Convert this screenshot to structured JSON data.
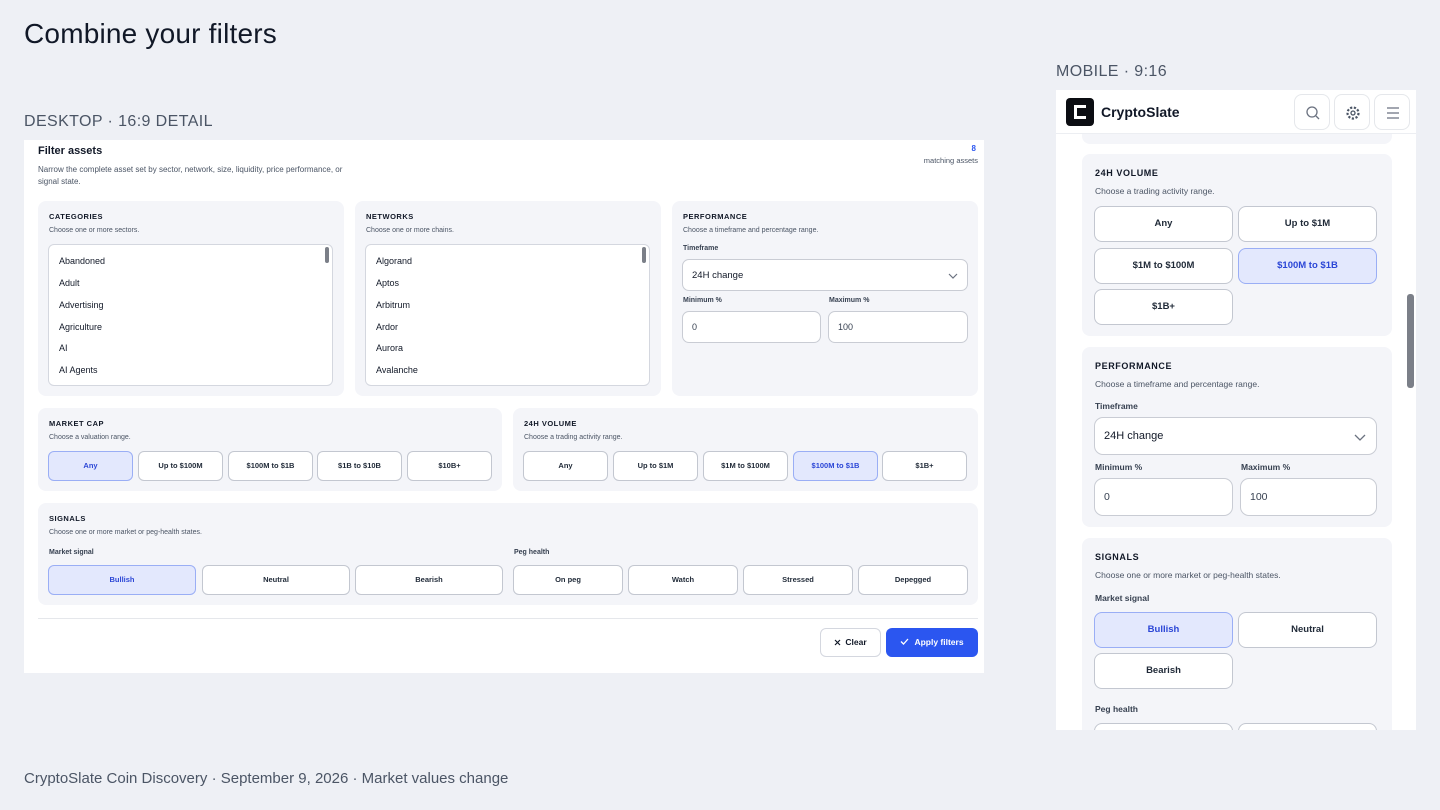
{
  "page": {
    "title": "Combine your filters",
    "desktop_label": "DESKTOP · 16:9 DETAIL",
    "mobile_label": "MOBILE · 9:16",
    "footer": "CryptoSlate Coin Discovery · September 9, 2026 · Market values change"
  },
  "desktop": {
    "title": "Filter assets",
    "description": "Narrow the complete asset set by sector, network, size, liquidity, price performance, or signal state.",
    "count_value": "8",
    "count_label": "matching assets",
    "categories": {
      "title": "CATEGORIES",
      "desc": "Choose one or more sectors.",
      "items": [
        "Abandoned",
        "Adult",
        "Advertising",
        "Agriculture",
        "AI",
        "AI Agents"
      ]
    },
    "networks": {
      "title": "NETWORKS",
      "desc": "Choose one or more chains.",
      "items": [
        "Algorand",
        "Aptos",
        "Arbitrum",
        "Ardor",
        "Aurora",
        "Avalanche"
      ]
    },
    "performance": {
      "title": "PERFORMANCE",
      "desc": "Choose a timeframe and percentage range.",
      "timeframe_label": "Timeframe",
      "timeframe_value": "24H change",
      "min_label": "Minimum %",
      "min_value": "0",
      "max_label": "Maximum %",
      "max_value": "100"
    },
    "market_cap": {
      "title": "MARKET CAP",
      "desc": "Choose a valuation range.",
      "options": [
        "Any",
        "Up to $100M",
        "$100M to $1B",
        "$1B to $10B",
        "$10B+"
      ],
      "selected": 0
    },
    "volume": {
      "title": "24H VOLUME",
      "desc": "Choose a trading activity range.",
      "options": [
        "Any",
        "Up to $1M",
        "$1M to $100M",
        "$100M to $1B",
        "$1B+"
      ],
      "selected": 3
    },
    "signals": {
      "title": "SIGNALS",
      "desc": "Choose one or more market or peg-health states.",
      "market_label": "Market signal",
      "market_options": [
        "Bullish",
        "Neutral",
        "Bearish"
      ],
      "market_selected": 0,
      "peg_label": "Peg health",
      "peg_options": [
        "On peg",
        "Watch",
        "Stressed",
        "Depegged"
      ]
    },
    "clear_label": "Clear",
    "apply_label": "Apply filters"
  },
  "mobile": {
    "brand": "CryptoSlate",
    "volume": {
      "title": "24H VOLUME",
      "desc": "Choose a trading activity range.",
      "options": [
        "Any",
        "Up to $1M",
        "$1M to $100M",
        "$100M to $1B",
        "$1B+"
      ],
      "selected": 3
    },
    "performance": {
      "title": "PERFORMANCE",
      "desc": "Choose a timeframe and percentage range.",
      "timeframe_label": "Timeframe",
      "timeframe_value": "24H change",
      "min_label": "Minimum %",
      "min_value": "0",
      "max_label": "Maximum %",
      "max_value": "100"
    },
    "signals": {
      "title": "SIGNALS",
      "desc": "Choose one or more market or peg-health states.",
      "market_label": "Market signal",
      "market_options": [
        "Bullish",
        "Neutral",
        "Bearish"
      ],
      "market_selected": 0,
      "peg_label": "Peg health"
    }
  },
  "icons": [
    "search-icon",
    "gear-icon",
    "menu-icon",
    "chevron-down-icon",
    "check-icon",
    "close-icon",
    "cryptoslate-logo"
  ],
  "colors": {
    "accent": "#2b56f0",
    "selected_bg": "#e3e8fd",
    "selected_text": "#2b46d6",
    "card_bg": "#f4f5f9",
    "page_bg": "#eef0f5"
  }
}
